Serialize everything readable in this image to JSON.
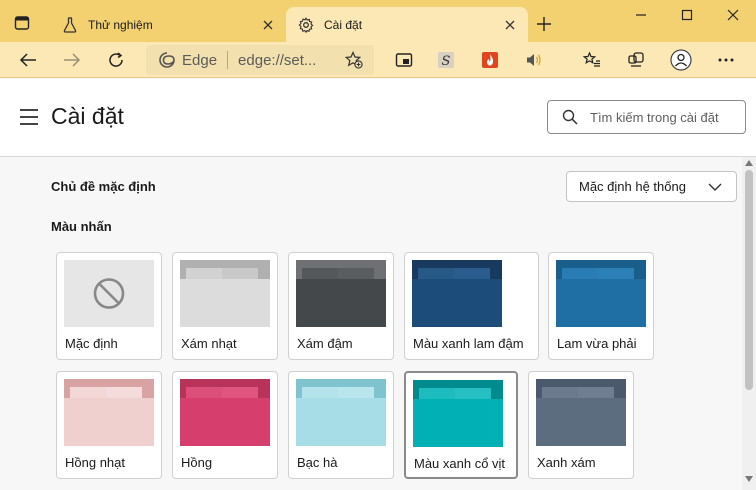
{
  "browser": {
    "tabs": [
      {
        "title": "Thử nghiệm",
        "icon": "flask-icon",
        "active": false
      },
      {
        "title": "Cài đặt",
        "icon": "gear-icon",
        "active": true
      }
    ],
    "address": {
      "site_label": "Edge",
      "url": "edge://set..."
    },
    "colors": {
      "accent": "#f3d171",
      "toolbar": "#fbe8b5"
    }
  },
  "settings": {
    "title": "Cài đặt",
    "search_placeholder": "Tìm kiếm trong cài đặt",
    "default_theme_label": "Chủ đề mặc định",
    "default_theme_value": "Mặc định hệ thống",
    "accent_label": "Màu nhấn",
    "accent_options": [
      {
        "name": "Mặc định",
        "type": "default",
        "base": "#e6e6e6",
        "tab": "",
        "light": ""
      },
      {
        "name": "Xám nhạt",
        "type": "folder",
        "base": "#dcdcdc",
        "tab": "#c9c9c9",
        "light": "#d2d2d2",
        "top": "#b0b0b0"
      },
      {
        "name": "Xám đậm",
        "type": "folder",
        "base": "#45484b",
        "tab": "#5a5d60",
        "light": "#55585b",
        "top": "#6e7073"
      },
      {
        "name": "Màu xanh lam đậm",
        "type": "folder",
        "base": "#1c4c7a",
        "tab": "#2a5d8e",
        "light": "#275987",
        "top": "#173a5e"
      },
      {
        "name": "Lam vừa phải",
        "type": "folder",
        "base": "#1f6fa5",
        "tab": "#2c80b8",
        "light": "#2a7db4",
        "top": "#1a5e8c"
      },
      {
        "name": "Hồng nhạt",
        "type": "folder",
        "base": "#f0cfcf",
        "tab": "#f5dcdc",
        "light": "#f3d7d7",
        "top": "#d9a3a3"
      },
      {
        "name": "Hồng",
        "type": "folder",
        "base": "#d63e6e",
        "tab": "#e0557f",
        "light": "#dc4f7a",
        "top": "#b83359"
      },
      {
        "name": "Bạc hà",
        "type": "folder",
        "base": "#a6dde6",
        "tab": "#b9e6ed",
        "light": "#b4e3eb",
        "top": "#7fc3cf"
      },
      {
        "name": "Màu xanh cổ vịt",
        "type": "folder",
        "base": "#00b0b4",
        "tab": "#26c0c3",
        "light": "#1dbcbf",
        "top": "#008b8e"
      },
      {
        "name": "Xanh xám",
        "type": "folder",
        "base": "#5c6d80",
        "tab": "#6f7f91",
        "light": "#6b7b8d",
        "top": "#4a5a6c"
      }
    ]
  }
}
